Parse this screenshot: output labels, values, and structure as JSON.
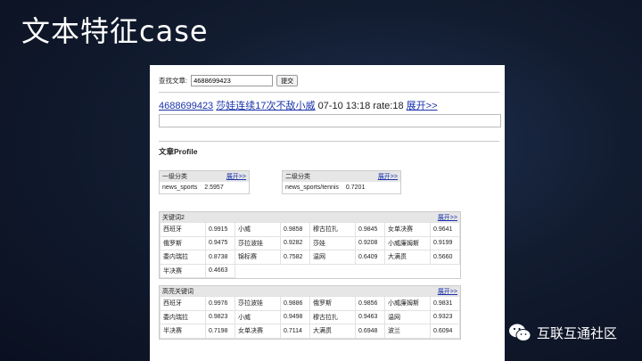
{
  "slide": {
    "title": "文本特征case"
  },
  "search": {
    "label": "查找文章:",
    "value": "4688699423",
    "submit_label": "提交"
  },
  "article": {
    "id": "4688699423",
    "title": "莎娃连续17次不敌小威",
    "date": "07-10 13:18",
    "rate": "rate:18",
    "expand": "展开>>"
  },
  "profile": {
    "title": "文章Profile"
  },
  "category1": {
    "header": "一级分类",
    "expand": "展开>>",
    "name": "news_sports",
    "score": "2.5957"
  },
  "category2": {
    "header": "二级分类",
    "expand": "展开>>",
    "name": "news_sports/tennis",
    "score": "0.7201"
  },
  "keywords2": {
    "header": "关键词2",
    "expand": "展开>>",
    "rows": [
      [
        [
          "西班牙",
          "0.9915"
        ],
        [
          "小威",
          "0.9858"
        ],
        [
          "穆古拉扎",
          "0.9845"
        ],
        [
          "女单决赛",
          "0.9641"
        ]
      ],
      [
        [
          "俄罗斯",
          "0.9475"
        ],
        [
          "莎拉波娃",
          "0.9282"
        ],
        [
          "莎娃",
          "0.9208"
        ],
        [
          "小威廉姆斯",
          "0.9199"
        ]
      ],
      [
        [
          "委内瑞拉",
          "0.8738"
        ],
        [
          "锦标赛",
          "0.7582"
        ],
        [
          "温网",
          "0.6409"
        ],
        [
          "大满贯",
          "0.5660"
        ]
      ],
      [
        [
          "半决赛",
          "0.4663"
        ]
      ]
    ]
  },
  "highlight": {
    "header": "高亮关键词",
    "expand": "展开>>",
    "rows": [
      [
        [
          "西班牙",
          "0.9976"
        ],
        [
          "莎拉波娃",
          "0.9886"
        ],
        [
          "俄罗斯",
          "0.9856"
        ],
        [
          "小威廉姆斯",
          "0.9831"
        ]
      ],
      [
        [
          "委内瑞拉",
          "0.9823"
        ],
        [
          "小威",
          "0.9498"
        ],
        [
          "穆古拉扎",
          "0.9463"
        ],
        [
          "温网",
          "0.9323"
        ]
      ],
      [
        [
          "半决赛",
          "0.7198"
        ],
        [
          "女单决赛",
          "0.7114"
        ],
        [
          "大满贯",
          "0.6948"
        ],
        [
          "波兰",
          "0.6094"
        ]
      ]
    ]
  },
  "brand": {
    "name": "互联互通社区",
    "icon": "wechat-icon"
  }
}
